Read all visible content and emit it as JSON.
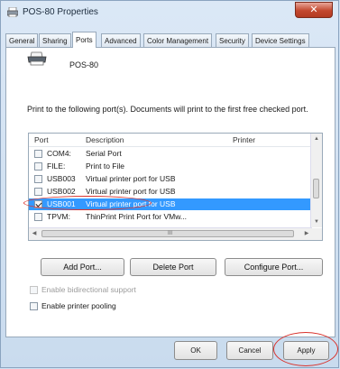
{
  "window": {
    "title": "POS-80 Properties",
    "close_glyph": "✕"
  },
  "tabs": [
    {
      "label": "General"
    },
    {
      "label": "Sharing"
    },
    {
      "label": "Ports"
    },
    {
      "label": "Advanced"
    },
    {
      "label": "Color Management"
    },
    {
      "label": "Security"
    },
    {
      "label": "Device Settings"
    }
  ],
  "active_tab": "Ports",
  "printer": {
    "name": "POS-80",
    "icon": "printer-icon"
  },
  "instructions": "Print to the following port(s). Documents will print to the first free checked port.",
  "ports_list": {
    "columns": [
      "Port",
      "Description",
      "Printer"
    ],
    "rows": [
      {
        "port": "COM4:",
        "description": "Serial Port",
        "checked": false
      },
      {
        "port": "FILE:",
        "description": "Print to File",
        "checked": false
      },
      {
        "port": "USB003",
        "description": "Virtual printer port for USB",
        "checked": false
      },
      {
        "port": "USB002",
        "description": "Virtual printer port for USB",
        "checked": false
      },
      {
        "port": "USB001",
        "description": "Virtual printer port for USB",
        "checked": true,
        "selected": true
      },
      {
        "port": "TPVM:",
        "description": "ThinPrint Print Port for VMw...",
        "checked": false
      }
    ],
    "scroll_grip": "III"
  },
  "buttons": {
    "add_port": "Add Port...",
    "delete_port": "Delete Port",
    "configure_port": "Configure Port...",
    "ok": "OK",
    "cancel": "Cancel",
    "apply": "Apply"
  },
  "options": {
    "bidirectional": {
      "label": "Enable bidirectional support",
      "checked": false,
      "disabled": true
    },
    "pooling": {
      "label": "Enable printer pooling",
      "checked": false,
      "disabled": false
    }
  },
  "colors": {
    "selection": "#3399ff",
    "annotation": "#d9322c",
    "close_button": "#c3482f"
  }
}
